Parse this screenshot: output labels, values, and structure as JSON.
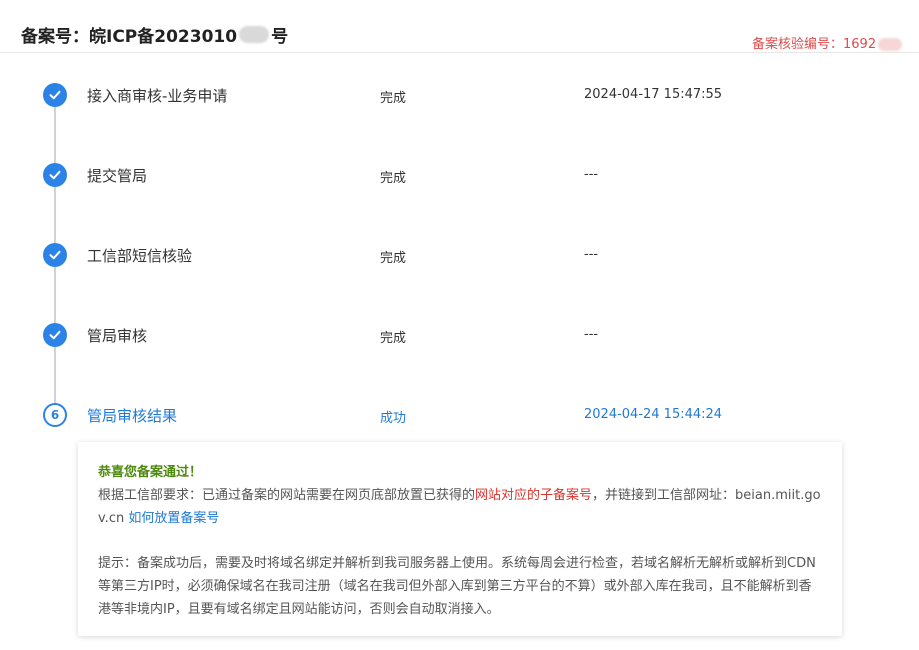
{
  "header": {
    "icp_prefix": "备案号：皖ICP备2023010",
    "icp_suffix": "号",
    "verify_label": "备案核验编号：",
    "verify_value": "1692"
  },
  "steps": [
    {
      "icon": "check",
      "name": "接入商审核-业务申请",
      "status": "完成",
      "time": "2024-04-17 15:47:55"
    },
    {
      "icon": "check",
      "name": "提交管局",
      "status": "完成",
      "time": "---"
    },
    {
      "icon": "check",
      "name": "工信部短信核验",
      "status": "完成",
      "time": "---"
    },
    {
      "icon": "check",
      "name": "管局审核",
      "status": "完成",
      "time": "---"
    },
    {
      "icon": "number",
      "number": "6",
      "name": "管局审核结果",
      "status": "成功",
      "time": "2024-04-24 15:44:24"
    }
  ],
  "notice": {
    "title": "恭喜您备案通过！",
    "line1_a": "根据工信部要求：已通过备案的网站需要在网页底部放置已获得的",
    "line1_red": "网站对应的子备案号",
    "line1_b": "，并链接到工信部网址：beian.miit.gov.cn ",
    "link": "如何放置备案号",
    "tip": "提示：备案成功后，需要及时将域名绑定并解析到我司服务器上使用。系统每周会进行检查，若域名解析无解析或解析到CDN等第三方IP时，必须确保域名在我司注册（域名在我司但外部入库到第三方平台的不算）或外部入库在我司，且不能解析到香港等非境内IP，且要有域名绑定且网站能访问，否则会自动取消接入。"
  },
  "colors": {
    "accent": "#2b83e8",
    "link": "#1f7ad6",
    "success_title": "#4f8a10",
    "highlight": "#d9342b",
    "verify": "#e04b4b"
  }
}
